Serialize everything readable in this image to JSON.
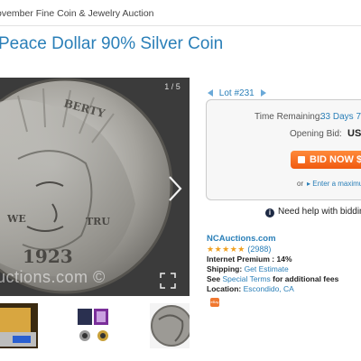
{
  "header": {
    "auction_name": "ovember Fine Coin & Jewelry Auction"
  },
  "title": "Peace Dollar 90% Silver Coin",
  "gallery": {
    "counter": "1 / 5",
    "watermark": "uctions.com ©"
  },
  "lot": {
    "label": "Lot #231"
  },
  "bidding": {
    "time_remaining_label": "Time Remaining:",
    "time_remaining_value": "33 Days 7 I",
    "opening_bid_label": "Opening Bid:",
    "opening_bid_value": "US",
    "bid_button_label": "BID NOW $",
    "or_text": "or",
    "max_bid_link": "▸ Enter a maximu"
  },
  "help_text": "Need help with biddin",
  "seller": {
    "name": "NCAuctions.com",
    "stars": "★★★★★",
    "rating_count": "(2988)",
    "premium_label": "Internet Premium :",
    "premium_value": "14%",
    "shipping_label": "Shipping:",
    "shipping_value": "Get Estimate",
    "terms_prefix": "See",
    "terms_link": "Special Terms",
    "terms_suffix": "for additional fees",
    "location_label": "Location:",
    "location_value": "Escondido, CA",
    "badge": "eBay"
  },
  "colors": {
    "link": "#2a7fb8",
    "bid_button": "#f26a1b",
    "stars": "#f0a020"
  }
}
